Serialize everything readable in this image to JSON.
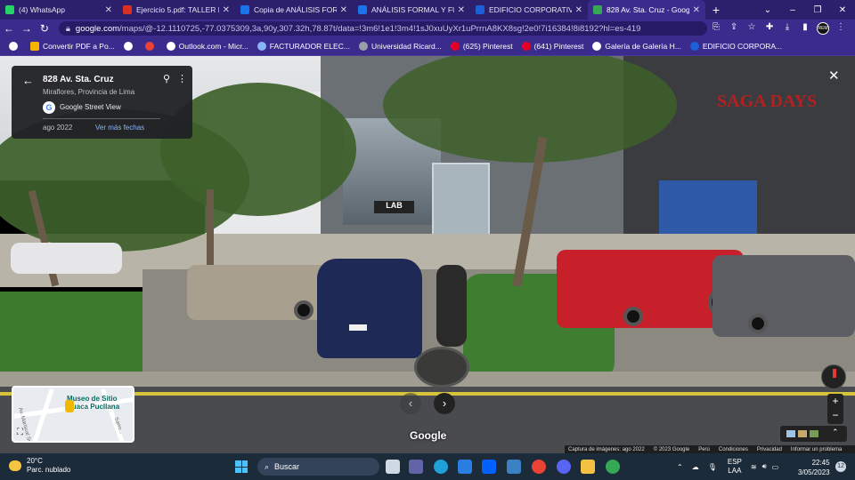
{
  "browser": {
    "tabs": [
      {
        "title": "(4) WhatsApp",
        "color": "#25d366"
      },
      {
        "title": "Ejercicio 5.pdf: TALLER DE D",
        "color": "#d93025"
      },
      {
        "title": "Copia de ANÁLISIS FORMAL",
        "color": "#1a73e8"
      },
      {
        "title": "ANÁLISIS FORMAL Y FUNCI",
        "color": "#1a73e8"
      },
      {
        "title": "EDIFICIO CORPORATIVO SA",
        "color": "#1c5fd6"
      },
      {
        "title": "828 Av. Sta. Cruz - Google M",
        "color": "#34a853"
      }
    ],
    "new_tab": "+",
    "url_host": "google.com",
    "url_path": "/maps/@-12.1110725,-77.0375309,3a,90y,307.32h,78.87t/data=!3m6!1e1!3m4!1sJ0xuUyXr1uPrrnA8KX8sg!2e0!7i16384!8i8192?hl=es-419",
    "bookmarks": [
      {
        "label": "",
        "color": "#ffffff"
      },
      {
        "label": "Convertir PDF a Po...",
        "color": "#f4b400"
      },
      {
        "label": "",
        "color": "#ffffff"
      },
      {
        "label": "",
        "color": "#ea4335"
      },
      {
        "label": "Outlook.com - Micr...",
        "color": "#ffffff"
      },
      {
        "label": "FACTURADOR ELEC...",
        "color": "#8ab4f8"
      },
      {
        "label": "Universidad Ricard...",
        "color": "#9aa0a6"
      },
      {
        "label": "(625) Pinterest",
        "color": "#e60023"
      },
      {
        "label": "(641) Pinterest",
        "color": "#e60023"
      },
      {
        "label": "Galería de Galería H...",
        "color": "#ffffff"
      },
      {
        "label": "EDIFICIO CORPORA...",
        "color": "#1c5fd6"
      }
    ],
    "profile": "REM"
  },
  "streetview": {
    "title": "828 Av. Sta. Cruz",
    "subtitle": "Miraflores, Provincia de Lima",
    "provider": "Google Street View",
    "date": "ago 2022",
    "more_dates": "Ver más fechas",
    "building_sign": "LAB",
    "store_sign": "SAGA DAYS",
    "plate": "",
    "watermark": "Google",
    "credits": [
      "Captura de imágenes: ago 2022",
      "© 2023 Google",
      "Perú",
      "Condiciones",
      "Privacidad",
      "Informar un problema"
    ]
  },
  "minimap": {
    "label": "Museo de Sitio Huaca Pucllana",
    "streets": [
      "Av. Mariscal Sucre",
      "Sarro..."
    ]
  },
  "taskbar": {
    "temp": "20°C",
    "weather": "Parc. nublado",
    "search": "Buscar",
    "lang1": "ESP",
    "lang2": "LAA",
    "time": "22:45",
    "date": "3/05/2023",
    "notifications": "12"
  }
}
